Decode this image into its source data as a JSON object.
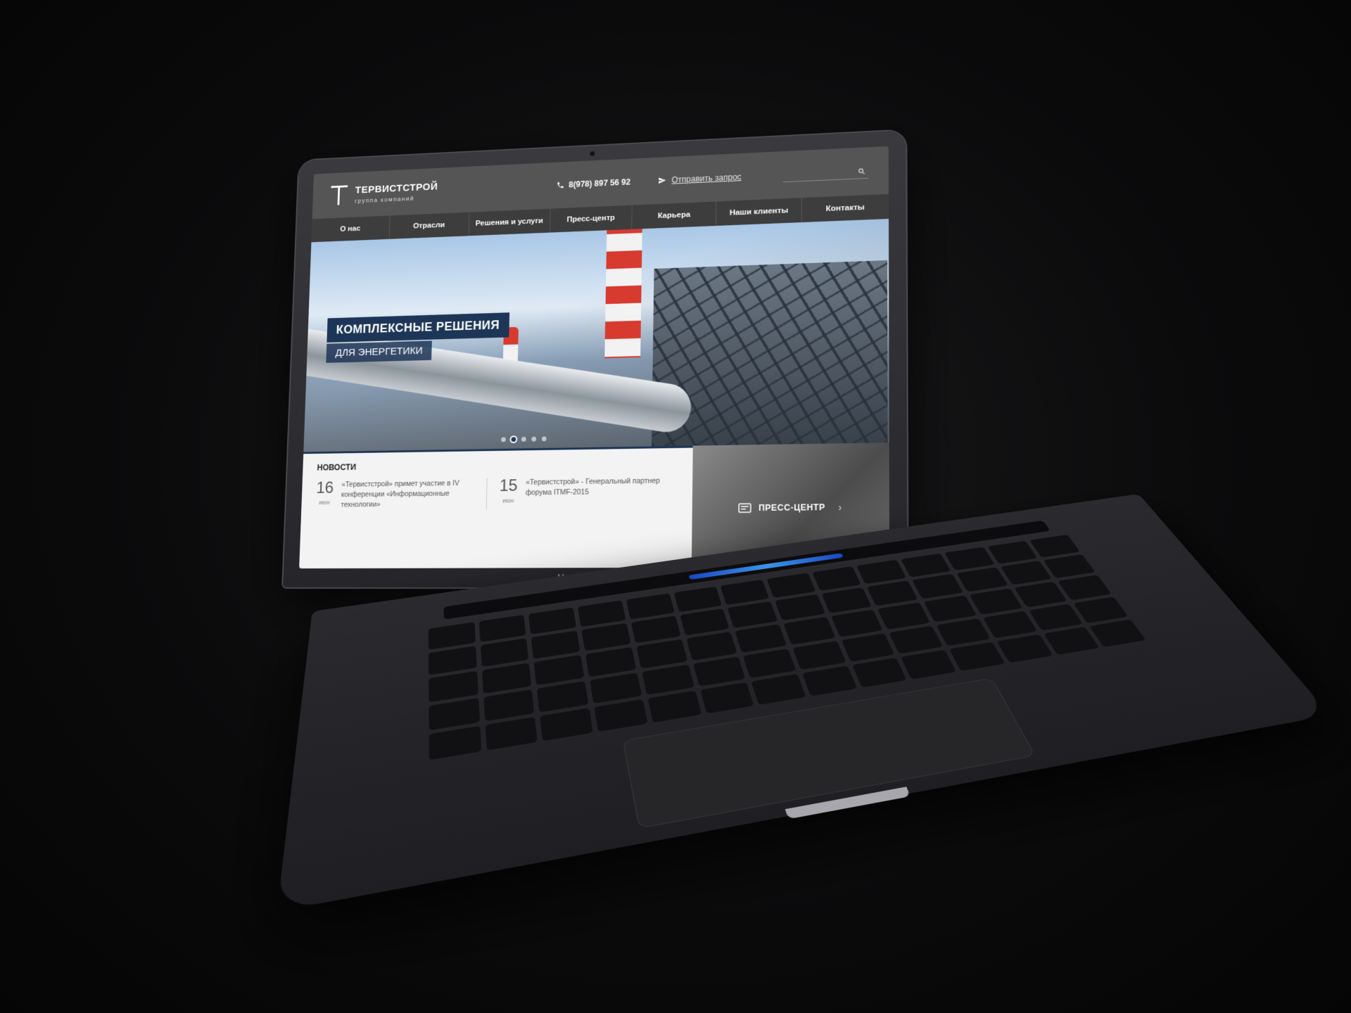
{
  "device": {
    "model_label": "MacBook Pro"
  },
  "site": {
    "logo": {
      "name": "ТЕРВИСТСТРОЙ",
      "subtitle": "группа компаний"
    },
    "header": {
      "phone": "8(978) 897 56 92",
      "request_link": "Отправить запрос",
      "search_placeholder": ""
    },
    "nav": [
      {
        "label": "О нас"
      },
      {
        "label": "Отрасли"
      },
      {
        "label": "Решения и услуги"
      },
      {
        "label": "Пресс-центр"
      },
      {
        "label": "Карьера"
      },
      {
        "label": "Наши клиенты"
      },
      {
        "label": "Контакты"
      }
    ],
    "hero": {
      "title": "КОМПЛЕКСНЫЕ РЕШЕНИЯ",
      "subtitle": "ДЛЯ ЭНЕРГЕТИКИ",
      "slides_total": 5,
      "slide_active": 2
    },
    "news": {
      "heading": "НОВОСТИ",
      "items": [
        {
          "day": "16",
          "month": "июн",
          "text": "«Тервистстрой» примет участие в IV конференции «Информационные технологии»"
        },
        {
          "day": "15",
          "month": "июн",
          "text": "«Тервистстрой» - Генеральный партнер форума ITMF-2015"
        }
      ]
    },
    "press": {
      "label": "ПРЕСС-ЦЕНТР"
    }
  },
  "colors": {
    "accent": "#1d3557",
    "header_bg": "#555555",
    "nav_bg": "#3d3d3d",
    "news_bg": "#f3f3f3"
  },
  "icons": {
    "phone": "phone-icon",
    "send": "send-icon",
    "search": "search-icon",
    "press": "newspaper-icon",
    "arrow": "chevron-right-icon"
  }
}
